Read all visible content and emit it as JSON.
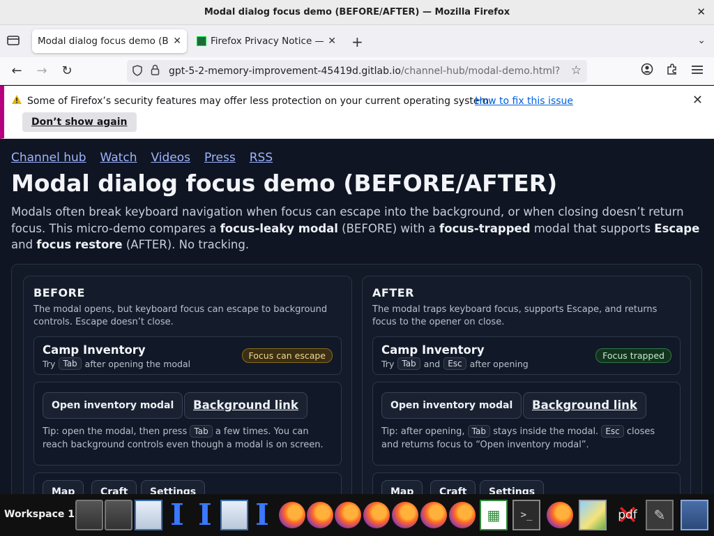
{
  "window": {
    "title": "Modal dialog focus demo (BEFORE/AFTER) — Mozilla Firefox",
    "close_glyph": "✕"
  },
  "tabs": [
    {
      "label": "Modal dialog focus demo (BEFORE/AFTER)",
      "close": "✕"
    },
    {
      "label": "Firefox Privacy Notice — Mozilla",
      "close": "✕"
    }
  ],
  "toolbar": {
    "new_tab": "+",
    "list_all_tabs": "⌄",
    "back": "←",
    "forward": "→",
    "reload": "↻"
  },
  "urlbar": {
    "host": "gpt-5-2-memory-improvement-45419d.gitlab.io",
    "path": "/channel-hub/modal-demo.html?c",
    "star": "☆"
  },
  "notice": {
    "message": "Some of Firefox’s security features may offer less protection on your current operating system.",
    "link": "How to fix this issue",
    "button": "Don’t show again"
  },
  "page": {
    "nav": [
      "Channel hub",
      "Watch",
      "Videos",
      "Press",
      "RSS"
    ],
    "title": "Modal dialog focus demo (BEFORE/AFTER)",
    "intro": {
      "p1": "Modals often break keyboard navigation when focus can escape into the background, or when closing doesn’t return focus. This micro-demo compares a ",
      "b1": "focus-leaky modal",
      "p2": " (BEFORE) with a ",
      "b2": "focus-trapped",
      "p3": " modal that supports ",
      "b3": "Escape",
      "p4": " and ",
      "b4": "focus restore",
      "p5": " (AFTER). No tracking."
    },
    "before": {
      "heading": "BEFORE",
      "desc": "The modal opens, but keyboard focus can escape to background controls. Escape doesn’t close.",
      "card_title": "Camp Inventory",
      "sub_try": "Try",
      "sub_key1": "Tab",
      "sub_rest": "after opening the modal",
      "badge": "Focus can escape",
      "open_btn": "Open inventory modal",
      "bg_link": "Background link",
      "tip_a": "Tip: open the modal, then press ",
      "tip_key": "Tab",
      "tip_b": " a few times. You can reach background controls even though a modal is on screen.",
      "chips": [
        "Map",
        "Craft",
        "Settings"
      ]
    },
    "after": {
      "heading": "AFTER",
      "desc": "The modal traps keyboard focus, supports Escape, and returns focus to the opener on close.",
      "card_title": "Camp Inventory",
      "sub_try": "Try",
      "sub_key1": "Tab",
      "sub_and": "and",
      "sub_key2": "Esc",
      "sub_rest": "after opening",
      "badge": "Focus trapped",
      "open_btn": "Open inventory modal",
      "bg_link": "Background link",
      "tip_a": "Tip: after opening, ",
      "tip_key1": "Tab",
      "tip_b": " stays inside the modal. ",
      "tip_key2": "Esc",
      "tip_c": " closes and returns focus to “Open inventory modal”.",
      "chips": [
        "Map",
        "Craft",
        "Settings"
      ]
    }
  },
  "taskbar": {
    "workspace": "Workspace 1",
    "pdf_label": "pdf"
  }
}
